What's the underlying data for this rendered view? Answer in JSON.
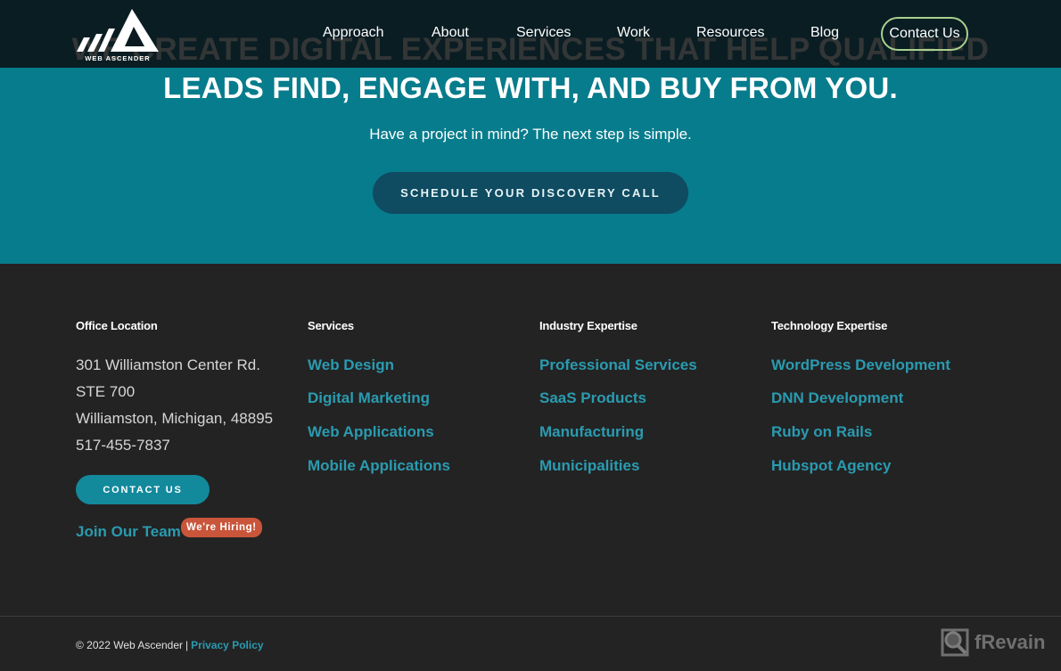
{
  "header": {
    "logo_text": "WEB ASCENDER",
    "nav": [
      {
        "label": "Approach"
      },
      {
        "label": "About"
      },
      {
        "label": "Services"
      },
      {
        "label": "Work"
      },
      {
        "label": "Resources"
      },
      {
        "label": "Blog"
      }
    ],
    "contact_label": "Contact Us"
  },
  "hero": {
    "title_line1": "WE CREATE DIGITAL EXPERIENCES THAT HELP QUALIFIED",
    "title_line2": "LEADS FIND, ENGAGE WITH, AND BUY FROM YOU.",
    "subtitle": "Have a project in mind? The next step is simple.",
    "cta_label": "SCHEDULE YOUR DISCOVERY CALL"
  },
  "footer": {
    "office": {
      "title": "Office Location",
      "lines": [
        "301 Williamston Center Rd.",
        "STE 700",
        "Williamston, Michigan, 48895",
        "517-455-7837"
      ],
      "contact_button": "CONTACT US",
      "join_label": "Join Our Team",
      "hiring_badge": "We're Hiring!"
    },
    "services": {
      "title": "Services",
      "links": [
        "Web Design",
        "Digital Marketing",
        "Web Applications",
        "Mobile Applications"
      ]
    },
    "industry": {
      "title": "Industry Expertise",
      "links": [
        "Professional Services",
        "SaaS Products",
        "Manufacturing",
        "Municipalities"
      ]
    },
    "technology": {
      "title": "Technology Expertise",
      "links": [
        "WordPress Development",
        "DNN Development",
        "Ruby on Rails",
        "Hubspot Agency"
      ]
    },
    "copyright": "© 2022 Web Ascender",
    "separator": "|",
    "privacy_label": "Privacy Policy"
  },
  "watermark": {
    "text": "fRevain"
  },
  "colors": {
    "hero_bg": "#077c8c",
    "header_bg": "#0a1a20",
    "cta_bg": "#0f4b61",
    "footer_bg": "#232323",
    "link": "#2a9bb0",
    "contact_border": "#a9d18e",
    "hiring_badge": "#c9553a"
  }
}
